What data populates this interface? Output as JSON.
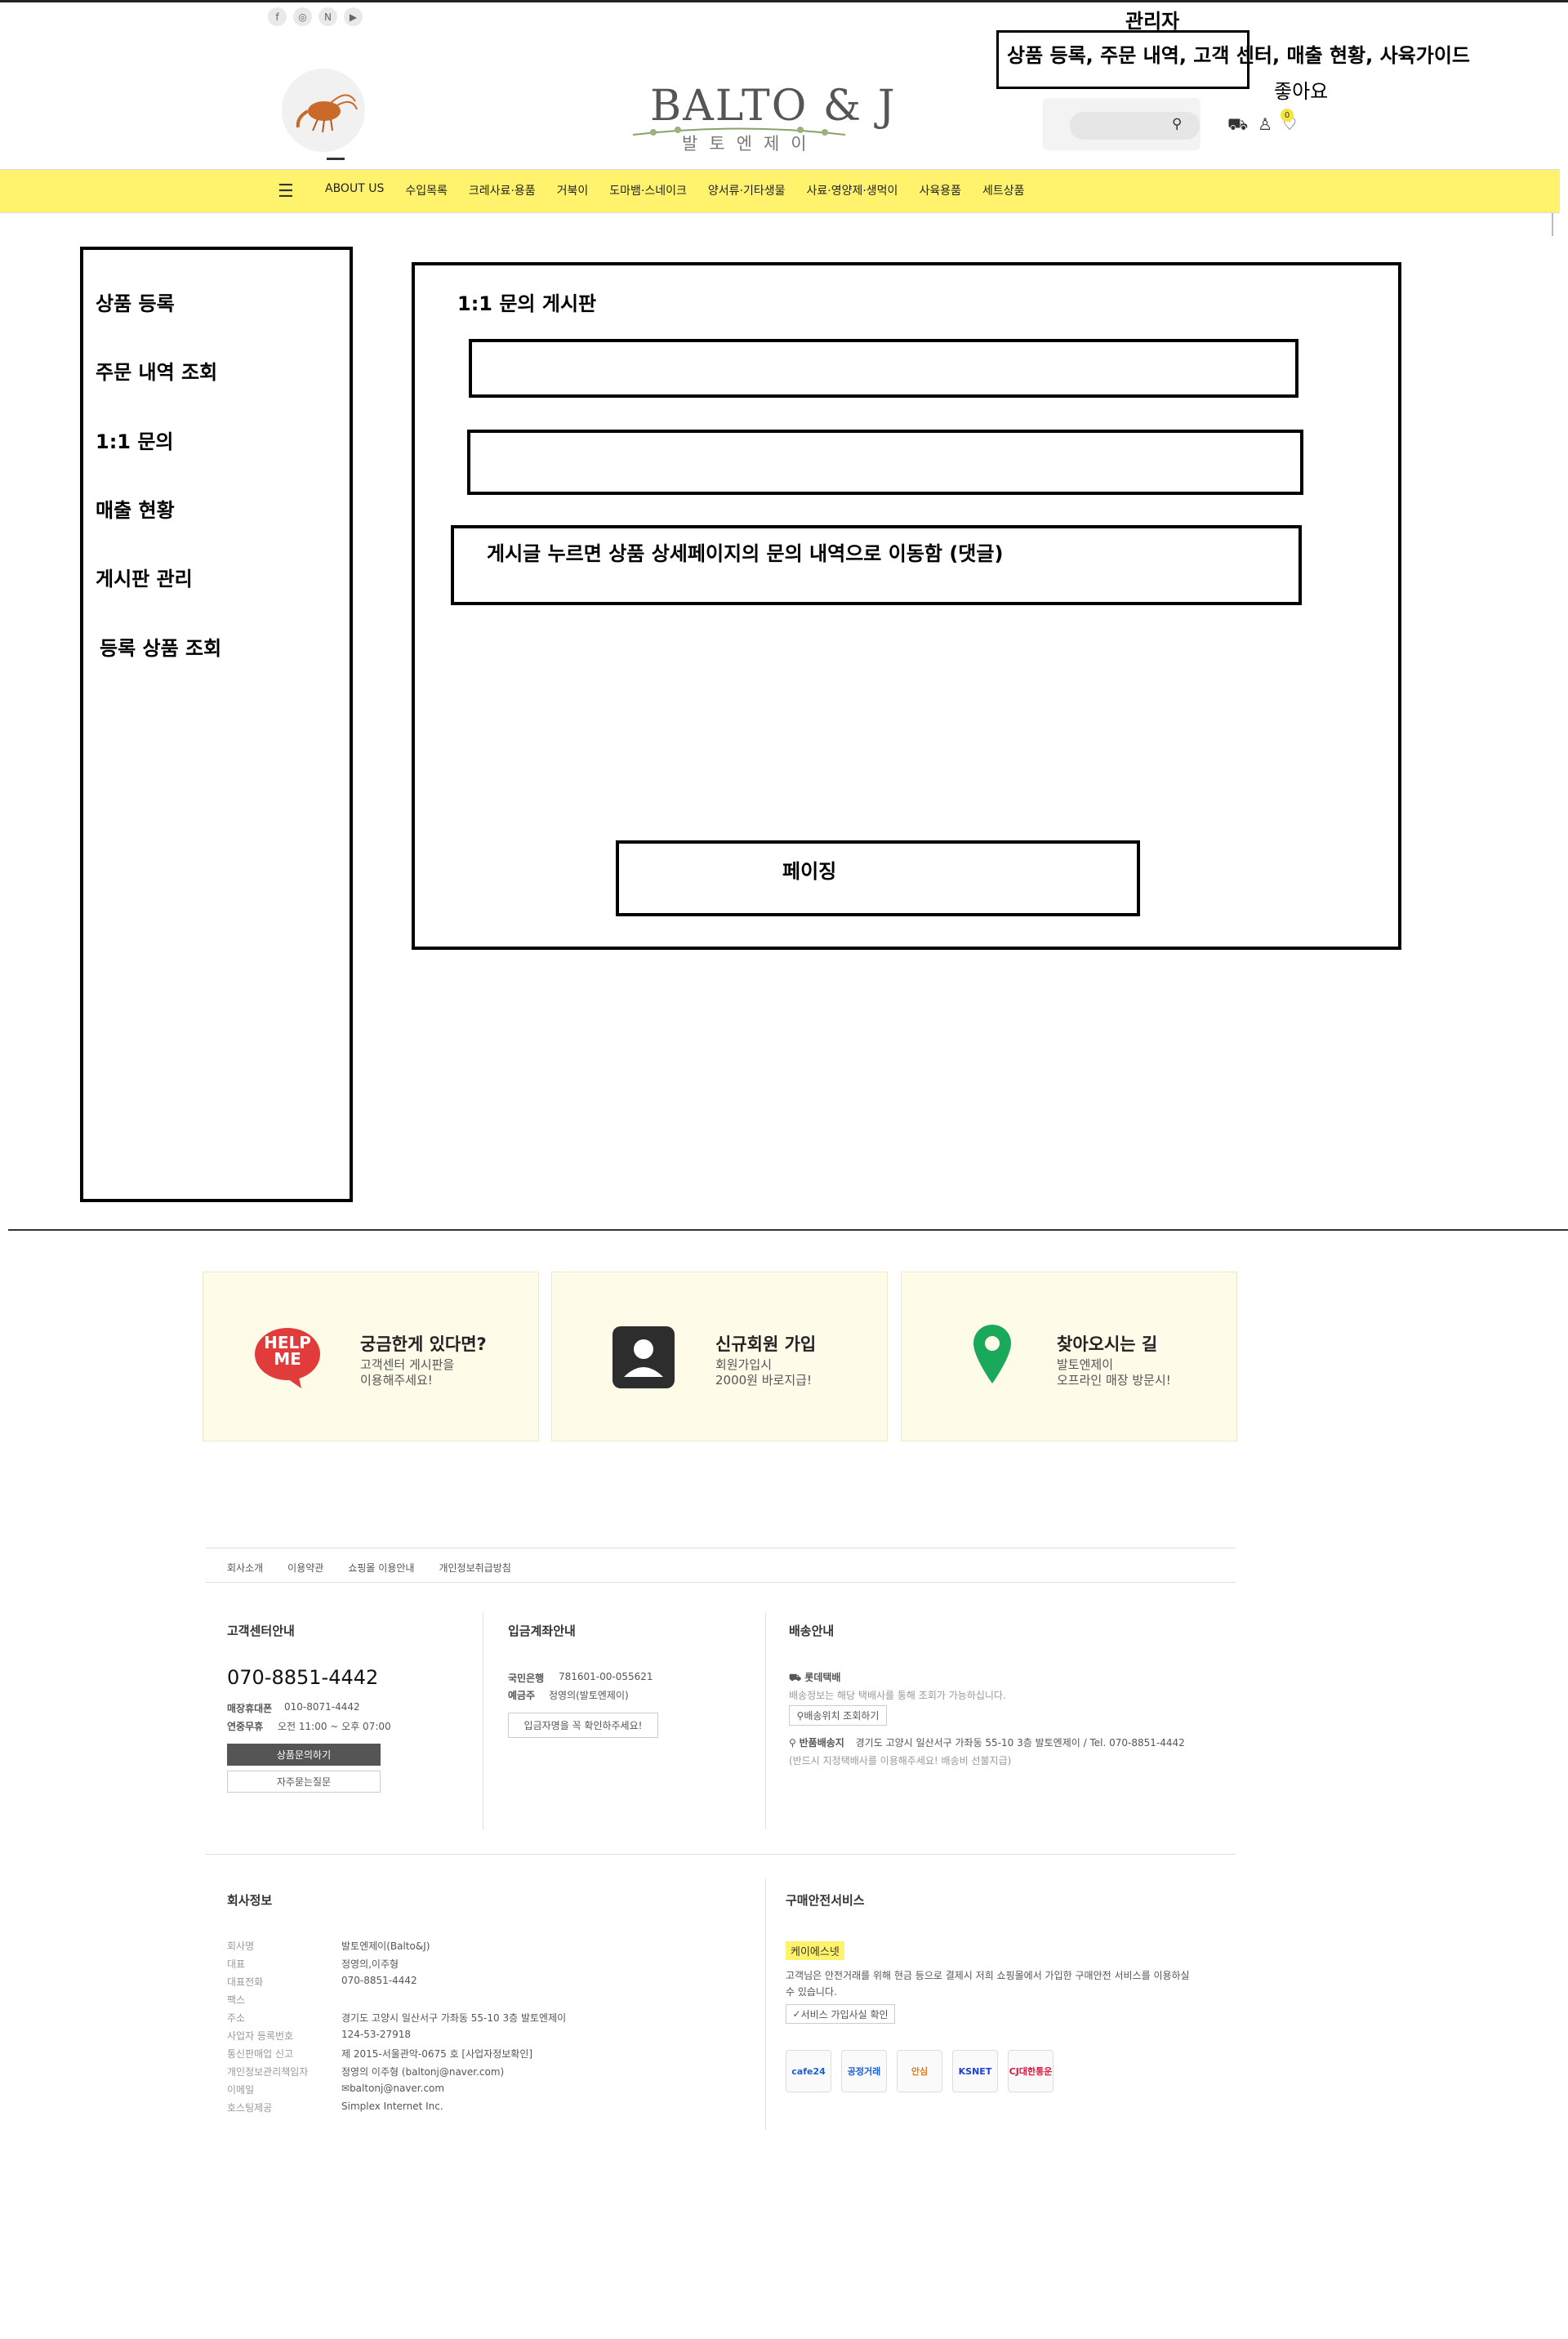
{
  "annotations": {
    "admin_label": "관리자",
    "admin_menu_text": "상품 등록, 주문 내역, 고객 센터, 매출 현황, 사육가이드",
    "like_text": "좋아요"
  },
  "header": {
    "logo_main": "BALTO & J",
    "logo_sub": "발토엔제이",
    "cart_badge": "0",
    "nav": {
      "items": [
        "ABOUT US",
        "수입목록",
        "크레사료·용품",
        "거북이",
        "도마뱀·스네이크",
        "양서류·기타생물",
        "사료·영양제·생먹이",
        "사육용품",
        "세트상품"
      ]
    }
  },
  "sidebar": {
    "items": [
      "상품 등록",
      "주문 내역 조회",
      "1:1 문의",
      "매출 현황",
      "게시판 관리",
      "등록 상품 조회"
    ]
  },
  "main": {
    "title": "1:1 문의 게시판",
    "rows": [
      "",
      "",
      "게시글 누르면 상품 상세페이지의 문의 내역으로 이동함 (댓글)"
    ],
    "paging": "페이징"
  },
  "cards": [
    {
      "title": "궁금한게 있다면?",
      "desc1": "고객센터 게시판을",
      "desc2": "이용해주세요!",
      "icon_text": "HELP ME"
    },
    {
      "title": "신규회원 가입",
      "desc1": "회원가입시",
      "desc2": "2000원 바로지급!"
    },
    {
      "title": "찾아오시는 길",
      "desc1": "발토엔제이",
      "desc2": "오프라인 매장 방문시!"
    }
  ],
  "footer": {
    "links": [
      "회사소개",
      "이용약관",
      "쇼핑몰 이용안내",
      "개인정보취급방침"
    ],
    "cs": {
      "title": "고객센터안내",
      "phone": "070-8851-4442",
      "line1_label": "매장휴대폰",
      "line1_value": "010-8071-4442",
      "line2_label": "연중무휴",
      "line2_value": "오전 11:00 ~ 오후 07:00",
      "btn1": "상품문의하기",
      "btn2": "자주묻는질문"
    },
    "bank": {
      "title": "입금계좌안내",
      "line1_label": "국민은행",
      "line1_value": "781601-00-055621",
      "line2_label": "예금주",
      "line2_value": "정영의(발토엔제이)",
      "btn": "입금자명을 꼭 확인하주세요!"
    },
    "delivery": {
      "title": "배송안내",
      "courier": "롯데택배",
      "courier_note": "배송정보는 해당 택배사를 통해 조회가 가능하십니다.",
      "track_btn": "배송위치 조회하기",
      "return_label": "반품배송지",
      "return_addr": "경기도 고양시 일산서구 가좌동 55-10 3층 발토엔제이 / Tel. 070-8851-4442",
      "return_note": "(반드시 지정택배사를 이용해주세요! 배송비 선불지급)"
    },
    "company": {
      "title": "회사정보",
      "rows": [
        {
          "k": "회사명",
          "v": "발토엔제이(Balto&J)"
        },
        {
          "k": "대표",
          "v": "정영의,이주형"
        },
        {
          "k": "대표전화",
          "v": "070-8851-4442"
        },
        {
          "k": "팩스",
          "v": ""
        },
        {
          "k": "주소",
          "v": "경기도 고양시 일산서구 가좌동 55-10 3층 발토엔제이"
        },
        {
          "k": "사업자 등록번호",
          "v": "124-53-27918"
        },
        {
          "k": "통신판매업 신고",
          "v": "제 2015-서울관악-0675 호 [사업자정보확인]"
        },
        {
          "k": "개인정보관리책임자",
          "v": "정영의 이주형 (baltonj@naver.com)"
        },
        {
          "k": "이메일",
          "v": "baltonj@naver.com"
        },
        {
          "k": "호스팅제공",
          "v": "Simplex Internet Inc."
        }
      ]
    },
    "safe": {
      "title": "구매안전서비스",
      "badge": "케이에스넷",
      "desc1": "고객님은 안전거래를 위해 현금 등으로 결제시 저희 쇼핑몰에서 가입한 구매안전 서비스를 이용하실",
      "desc2": "수 있습니다.",
      "btn": "서비스 가입사실 확인",
      "logos": [
        "cafe24",
        "공정거래",
        "안심",
        "KSNET",
        "CJ대한통운"
      ]
    }
  },
  "colors": {
    "nav_bg": "#fff36e",
    "card_bg": "#fffbe9",
    "pin": "#1aa85a",
    "help": "#e23b3b"
  }
}
